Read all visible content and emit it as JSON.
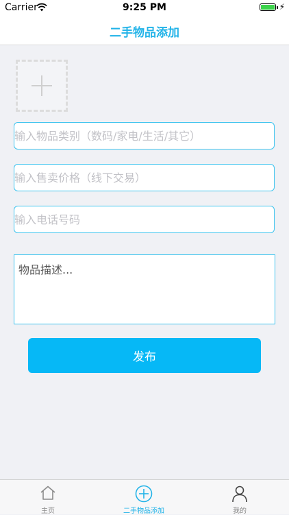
{
  "status_bar": {
    "carrier": "Carrier",
    "time": "9:25 PM",
    "wifi_icon": "wifi-icon",
    "battery_icon": "battery-icon"
  },
  "nav": {
    "title": "二手物品添加"
  },
  "form": {
    "photo_icon": "plus-icon",
    "category_placeholder": "输入物品类别（数码/家电/生活/其它）",
    "price_placeholder": "输入售卖价格（线下交易）",
    "phone_placeholder": "输入电话号码",
    "description_placeholder": "物品描述...",
    "publish_label": "发布"
  },
  "tabs": [
    {
      "label": "主页",
      "icon": "home-icon",
      "active": false
    },
    {
      "label": "二手物品添加",
      "icon": "add-circle-icon",
      "active": true
    },
    {
      "label": "我的",
      "icon": "person-icon",
      "active": false
    }
  ],
  "colors": {
    "accent": "#22b3e8",
    "button": "#06b8f6",
    "field_border": "#3cc3ee",
    "background": "#f0f1f5",
    "inactive_tab": "#8a8a8a"
  }
}
